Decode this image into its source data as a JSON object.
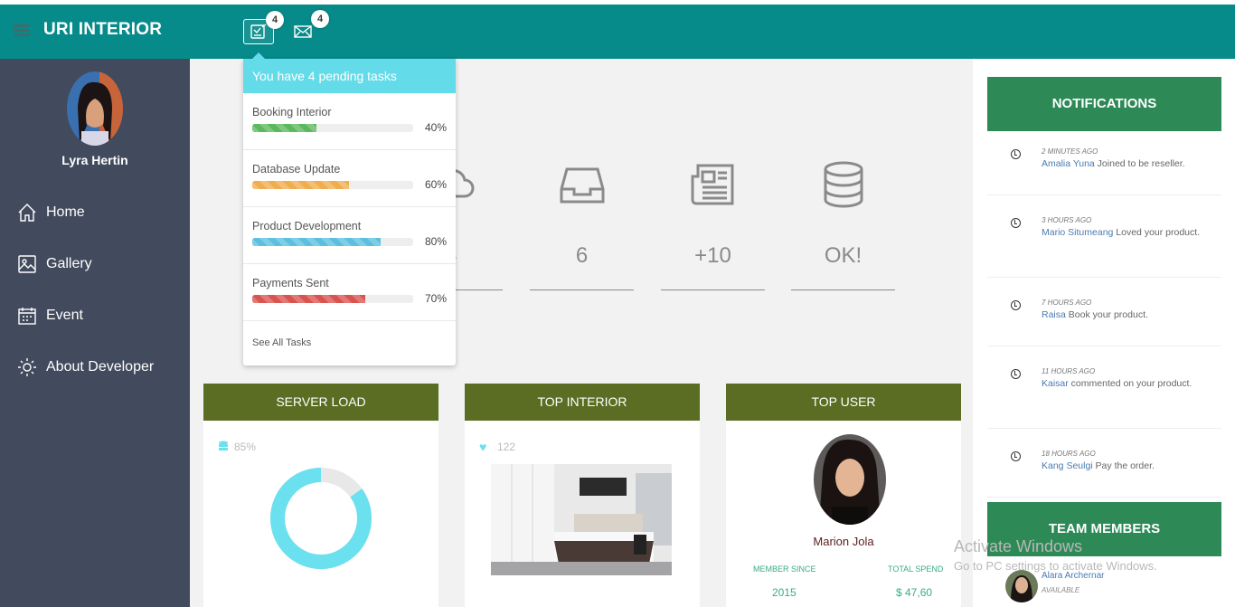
{
  "header": {
    "brand": "URI INTERIOR",
    "tasks_count": "4",
    "mail_count": "4"
  },
  "sidebar": {
    "user_name": "Lyra Hertin",
    "items": [
      {
        "label": "Home",
        "icon": "home-icon"
      },
      {
        "label": "Gallery",
        "icon": "gallery-icon"
      },
      {
        "label": "Event",
        "icon": "calendar-icon"
      },
      {
        "label": "About Developer",
        "icon": "developer-icon"
      }
    ]
  },
  "tasks_dropdown": {
    "title": "You have 4 pending tasks",
    "tasks": [
      {
        "name": "Booking Interior",
        "percent_label": "40%",
        "progress": 0.4,
        "color": "#5cb85c"
      },
      {
        "name": "Database Update",
        "percent_label": "60%",
        "progress": 0.6,
        "color": "#f0ad4e"
      },
      {
        "name": "Product Development",
        "percent_label": "80%",
        "progress": 0.8,
        "color": "#5bc0de"
      },
      {
        "name": "Payments Sent",
        "percent_label": "70%",
        "progress": 0.7,
        "color": "#d9534f"
      }
    ],
    "see_all": "See All Tasks"
  },
  "stats": [
    {
      "value": "4",
      "icon": "cloud-icon"
    },
    {
      "value": "6",
      "icon": "inbox-icon"
    },
    {
      "value": "+10",
      "icon": "newspaper-icon"
    },
    {
      "value": "OK!",
      "icon": "database-icon"
    }
  ],
  "panels": {
    "server_load": {
      "title": "SERVER LOAD",
      "value": "85%",
      "fraction": 0.85,
      "color": "#6be0ee"
    },
    "top_interior": {
      "title": "TOP INTERIOR",
      "likes": "122"
    },
    "top_user": {
      "title": "TOP USER",
      "name": "Marion Jola",
      "member_since_label": "MEMBER SINCE",
      "member_since": "2015",
      "total_spend_label": "TOTAL SPEND",
      "total_spend": "$ 47,60"
    }
  },
  "notifications": {
    "title": "NOTIFICATIONS",
    "items": [
      {
        "time": "2 MINUTES AGO",
        "who": "Amalia Yuna",
        "text": " Joined to be reseller."
      },
      {
        "time": "3 HOURS AGO",
        "who": "Mario Situmeang",
        "text": " Loved your product."
      },
      {
        "time": "7 HOURS AGO",
        "who": "Raisa",
        "text": " Book your product."
      },
      {
        "time": "11 HOURS AGO",
        "who": "Kaisar",
        "text": " commented on your product."
      },
      {
        "time": "18 HOURS AGO",
        "who": "Kang Seulgi",
        "text": " Pay the order."
      }
    ]
  },
  "team": {
    "title": "TEAM MEMBERS",
    "members": [
      {
        "name": "Alara Archernar",
        "status": "AVAILABLE"
      }
    ]
  },
  "watermark": {
    "line1": "Activate Windows",
    "line2": "Go to PC settings to activate Windows."
  }
}
